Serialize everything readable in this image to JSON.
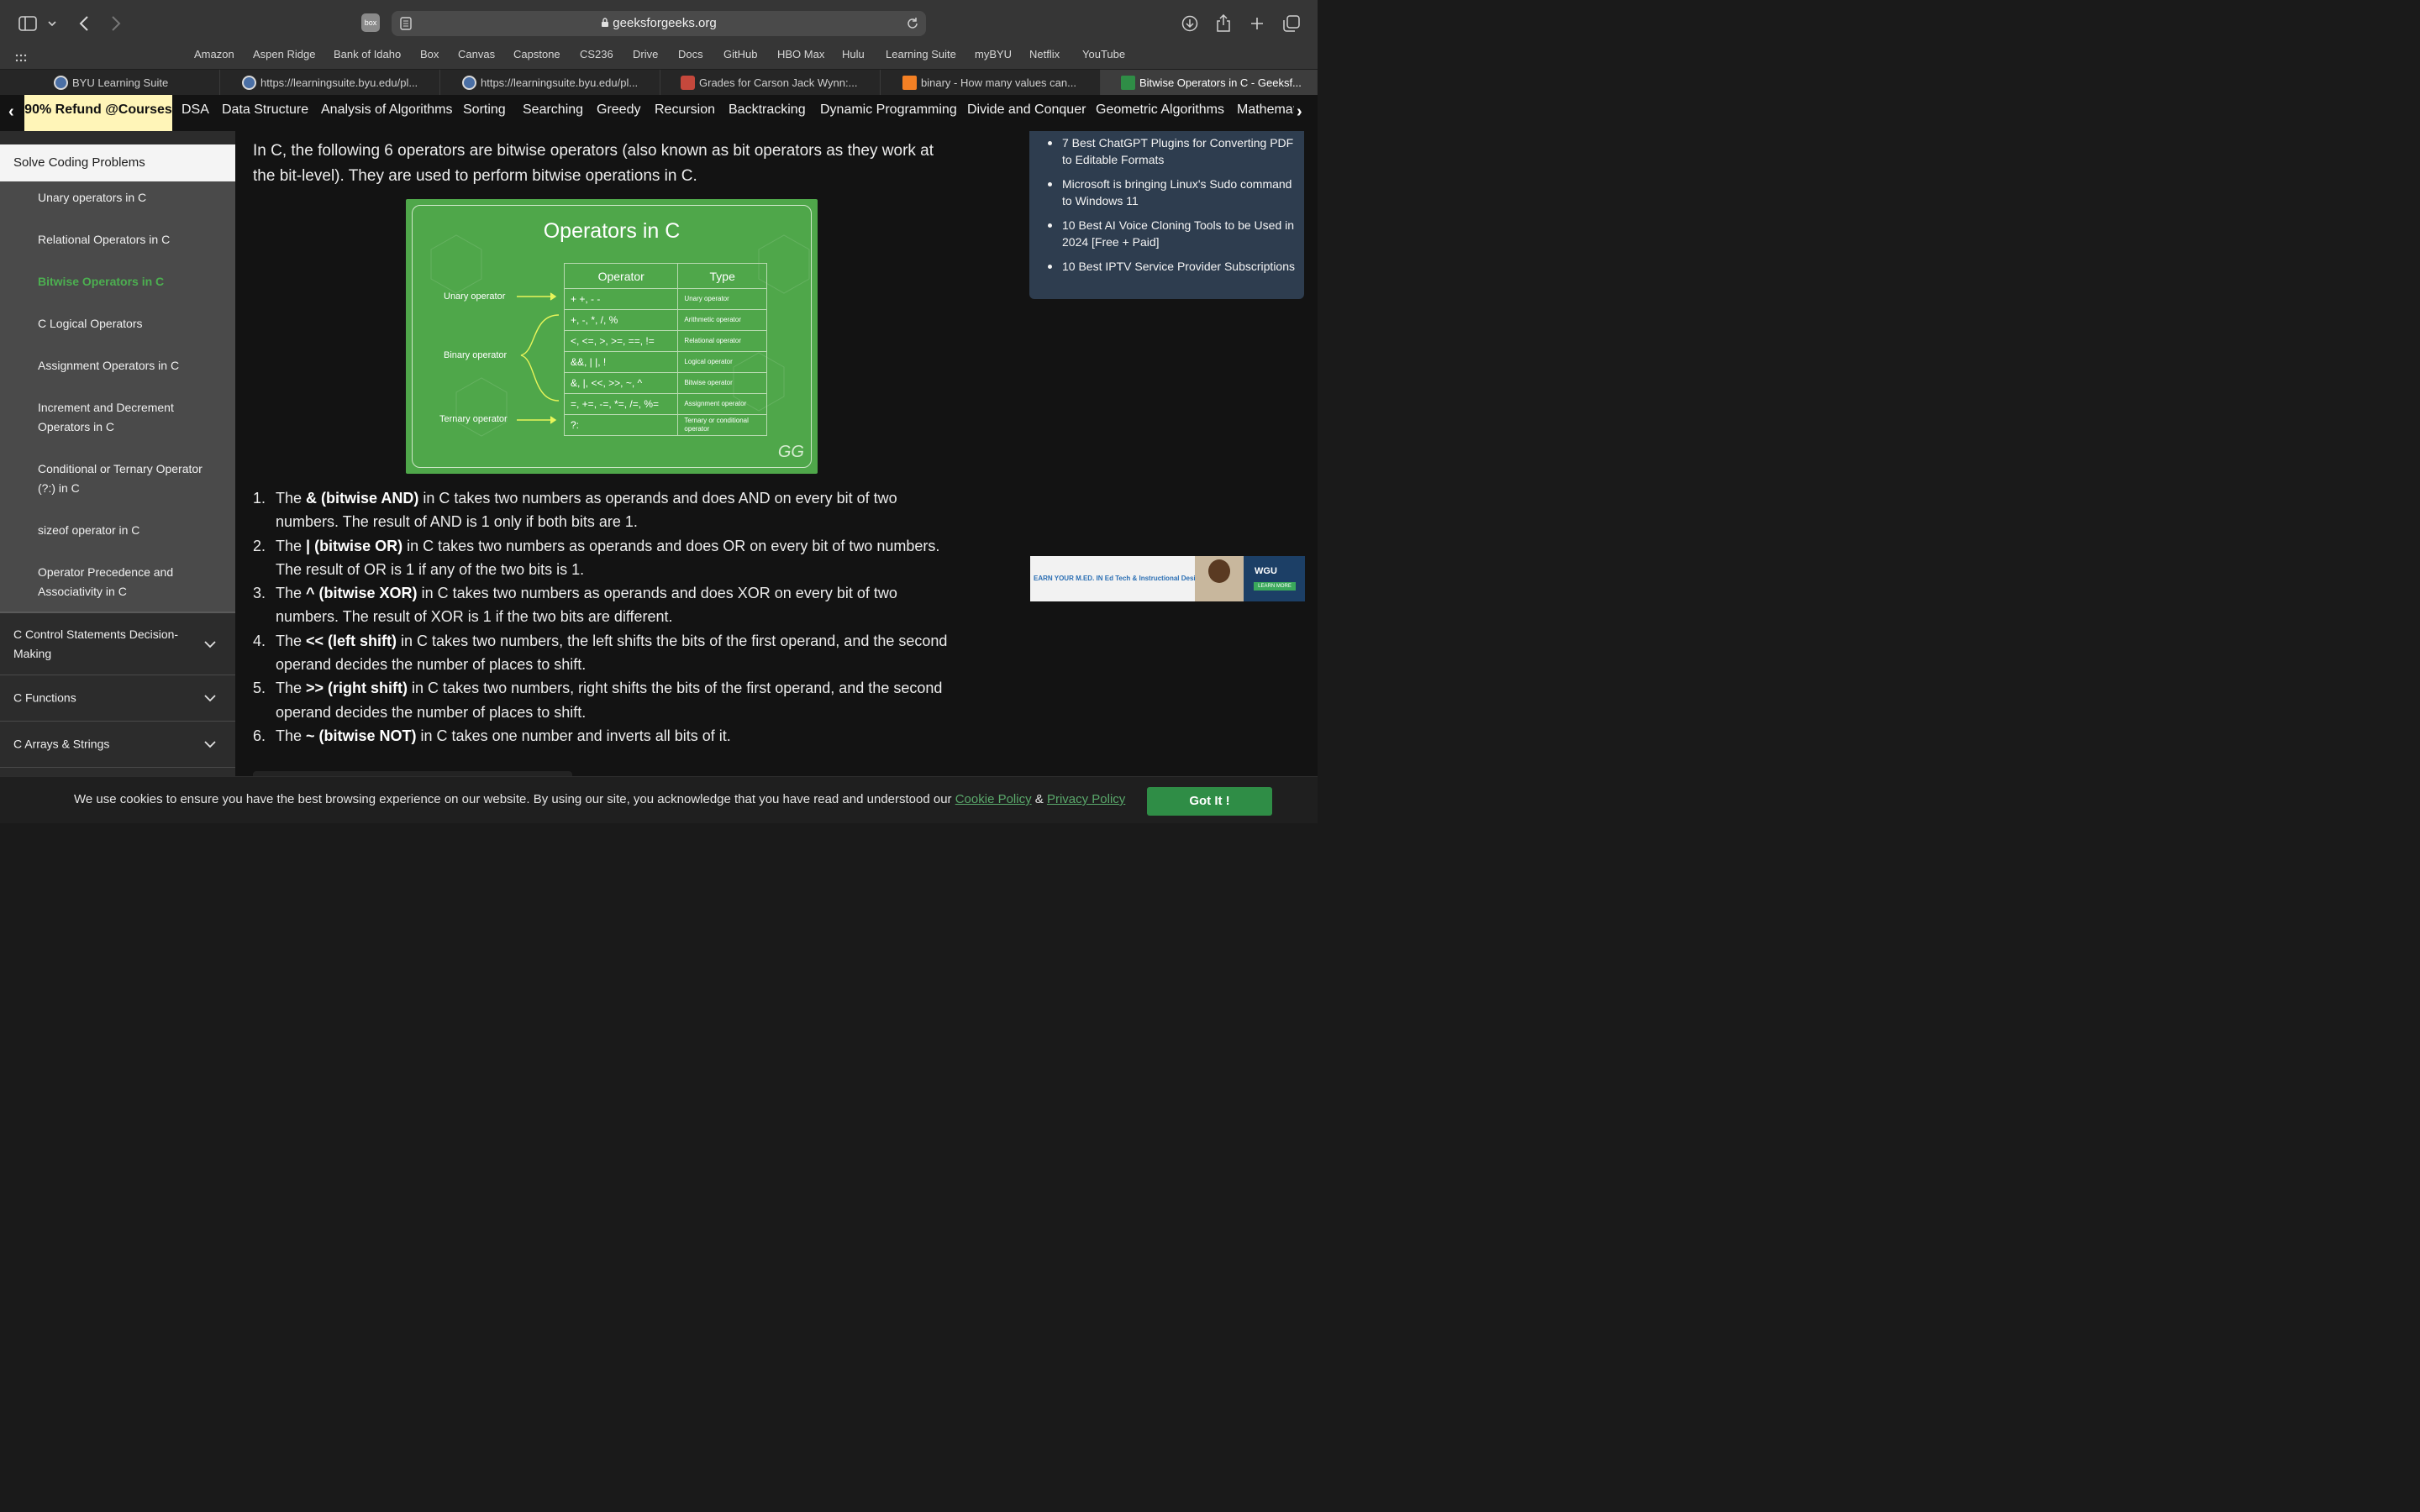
{
  "browser": {
    "url": "geeksforgeeks.org",
    "extension_label": "box",
    "favorites": [
      "Amazon",
      "Aspen Ridge",
      "Bank of Idaho",
      "Box",
      "Canvas",
      "Capstone",
      "CS236",
      "Drive",
      "Docs",
      "GitHub",
      "HBO Max",
      "Hulu",
      "Learning Suite",
      "myBYU",
      "Netflix",
      "YouTube"
    ],
    "tabs": [
      {
        "label": "BYU Learning Suite",
        "icon": "learning-suite-icon"
      },
      {
        "label": "https://learningsuite.byu.edu/pl...",
        "icon": "learning-suite-icon"
      },
      {
        "label": "https://learningsuite.byu.edu/pl...",
        "icon": "learning-suite-icon"
      },
      {
        "label": "Grades for Carson Jack Wynn:...",
        "icon": "grades-icon"
      },
      {
        "label": "binary - How many values can...",
        "icon": "stackoverflow-icon"
      },
      {
        "label": "Bitwise Operators in C - Geeksf...",
        "icon": "gfg-icon"
      }
    ],
    "active_tab": 5
  },
  "nav": {
    "promo": "90% Refund @Courses",
    "items": [
      "DSA",
      "Data Structure",
      "Analysis of Algorithms",
      "Sorting",
      "Searching",
      "Greedy",
      "Recursion",
      "Backtracking",
      "Dynamic Programming",
      "Divide and Conquer",
      "Geometric Algorithms",
      "Mathemati"
    ]
  },
  "sidebar": {
    "header": "Solve Coding Problems",
    "items": [
      "Unary operators in C",
      "Relational Operators in C",
      "Bitwise Operators in C",
      "C Logical Operators",
      "Assignment Operators in C",
      "Increment and Decrement Operators in C",
      "Conditional or Ternary Operator (?:) in C",
      "sizeof operator in C",
      "Operator Precedence and Associativity in C"
    ],
    "current": "Bitwise Operators in C",
    "sections": [
      "C Control Statements Decision-Making",
      "C Functions",
      "C Arrays & Strings"
    ]
  },
  "article": {
    "intro": "In C, the following 6 operators are bitwise operators (also known as bit operators as they work at the bit-level). They are used to perform bitwise operations in C.",
    "figure": {
      "title": "Operators in C",
      "col_operator": "Operator",
      "col_type": "Type",
      "rows": [
        {
          "op": "+ +, - -",
          "type": "Unary operator"
        },
        {
          "op": "+, -, *, /, %",
          "type": "Arithmetic operator"
        },
        {
          "op": "<, <=, >, >=, ==, !=",
          "type": "Relational operator"
        },
        {
          "op": "&&, | |, !",
          "type": "Logical operator"
        },
        {
          "op": "&, |, <<, >>, ~, ^",
          "type": "Bitwise operator"
        },
        {
          "op": "=, +=, -=, *=, /=, %=",
          "type": "Assignment operator"
        },
        {
          "op": "?:",
          "type": "Ternary or conditional operator"
        }
      ],
      "labels": {
        "unary": "Unary operator",
        "binary": "Binary operator",
        "ternary": "Ternary operator"
      },
      "watermark": "GG"
    },
    "list": [
      {
        "num": "1.",
        "pre": "The ",
        "bold": "& (bitwise AND)",
        "post": " in C takes two numbers as operands and does AND on every bit of two numbers. The result of AND is 1 only if both bits are 1."
      },
      {
        "num": "2.",
        "pre": "The ",
        "bold": "| (bitwise OR)",
        "post": " in C takes two numbers as operands and does OR on every bit of two numbers. The result of OR is 1 if any of the two bits is 1."
      },
      {
        "num": "3.",
        "pre": "The ",
        "bold": "^ (bitwise XOR)",
        "post": " in C takes two numbers as operands and does XOR on every bit of two numbers. The result of XOR is 1 if the two bits are different."
      },
      {
        "num": "4.",
        "pre": "The ",
        "bold": "<< (left shift)",
        "post": " in C takes two numbers, the left shifts the bits of the first operand, and the second operand decides the number of places to shift."
      },
      {
        "num": "5.",
        "pre": "The ",
        "bold": ">> (right shift)",
        "post": " in C takes two numbers, right shifts the bits of the first operand, and the second operand decides the number of places to shift."
      },
      {
        "num": "6.",
        "pre": "The ",
        "bold": "~ (bitwise NOT)",
        "post": " in C takes one number and inverts all bits of it."
      }
    ]
  },
  "right": {
    "news": [
      "7 Best ChatGPT Plugins for Converting PDF to Editable Formats",
      "Microsoft is bringing Linux's Sudo command to Windows 11",
      "10 Best AI Voice Cloning Tools to be Used in 2024 [Free + Paid]",
      "10 Best IPTV Service Provider Subscriptions"
    ],
    "ad": {
      "text": "EARN YOUR M.ED. IN Ed Tech & Instructional Design",
      "brand": "WGU",
      "cta": "LEARN MORE"
    }
  },
  "cookie": {
    "message": "We use cookies to ensure you have the best browsing experience on our website. By using our site, you acknowledge that you have read and understood our ",
    "cookie_policy": "Cookie Policy",
    "amp": " & ",
    "privacy_policy": "Privacy Policy",
    "button": "Got It !"
  },
  "colors": {
    "gfg_green": "#2f8d46",
    "current_item": "#4caf50",
    "promo_bg": "#fff5b8"
  }
}
